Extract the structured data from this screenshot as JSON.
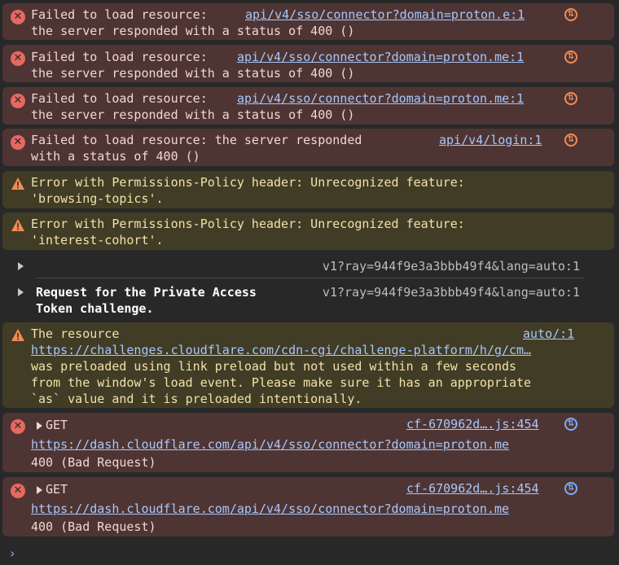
{
  "messages": [
    {
      "line1": "Failed to load resource:",
      "source": "api/v4/sso/connector?domain=proton.e:1",
      "line2": "the server responded with a status of 400 ()"
    },
    {
      "line1": "Failed to load resource:",
      "source": "api/v4/sso/connector?domain=proton.me:1",
      "line2": "the server responded with a status of 400 ()"
    },
    {
      "line1": "Failed to load resource:",
      "source": "api/v4/sso/connector?domain=proton.me:1",
      "line2": "the server responded with a status of 400 ()"
    },
    {
      "line1": "Failed to load resource: the server responded",
      "source": "api/v4/login:1",
      "line2": "with a status of 400 ()"
    }
  ],
  "warnings": [
    {
      "line1": "Error with Permissions-Policy header: Unrecognized feature:",
      "line2": "'browsing-topics'."
    },
    {
      "line1": "Error with Permissions-Policy header: Unrecognized feature:",
      "line2": "'interest-cohort'."
    }
  ],
  "groups": [
    {
      "label": "",
      "source": "v1?ray=944f9e3a3bbb49f4&lang=auto:1"
    },
    {
      "label_line1": "Request for the Private Access",
      "label_line2": "Token challenge.",
      "source": "v1?ray=944f9e3a3bbb49f4&lang=auto:1"
    }
  ],
  "preload_warning": {
    "line1": "The resource",
    "source": "auto/:1",
    "url": "https://challenges.cloudflare.com/cdn-cgi/challenge-platform/h/g/cm…",
    "line3": "was preloaded using link preload but not used within a few seconds",
    "line4": "from the window's load event. Please make sure it has an appropriate",
    "line5": "`as` value and it is preloaded intentionally."
  },
  "network_errors": [
    {
      "method": "GET",
      "source": "cf-670962d….js:454",
      "url": "https://dash.cloudflare.com/api/v4/sso/connector?domain=proton.me",
      "status": "400 (Bad Request)"
    },
    {
      "method": "GET",
      "source": "cf-670962d….js:454",
      "url": "https://dash.cloudflare.com/api/v4/sso/connector?domain=proton.me",
      "status": "400 (Bad Request)"
    }
  ],
  "prompt": "›",
  "colors": {
    "error_bg": "#4e3534",
    "warn_bg": "#413c26",
    "link": "#a8c7fa",
    "accent": "#f28b54"
  }
}
